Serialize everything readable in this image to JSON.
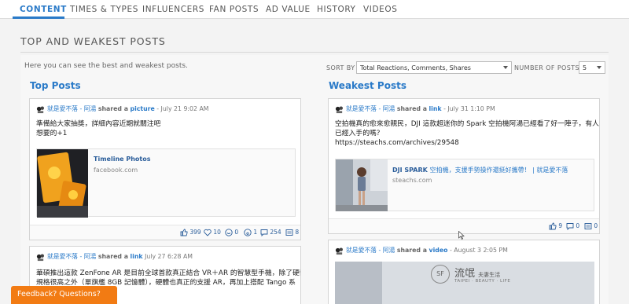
{
  "nav": {
    "tabs": [
      {
        "label": "CONTENT",
        "active": true
      },
      {
        "label": "TIMES & TYPES"
      },
      {
        "label": "INFLUENCERS"
      },
      {
        "label": "FAN POSTS"
      },
      {
        "label": "AD VALUE"
      },
      {
        "label": "HISTORY"
      },
      {
        "label": "VIDEOS"
      }
    ]
  },
  "section_title": "TOP AND WEAKEST POSTS",
  "intro": "Here you can see the best and weakest posts.",
  "controls": {
    "sort_label": "SORT BY",
    "sort_value": "Total Reactions, Comments, Shares",
    "number_label": "NUMBER OF POSTS",
    "number_value": "5"
  },
  "top": {
    "title": "Top Posts",
    "posts": [
      {
        "page": "就是愛不落 - 阿湯",
        "shared": "shared a",
        "type": "picture",
        "time": "- July 21 9:02 AM",
        "message_lines": [
          "準備給大家抽獎，詳細內容近期就關注吧",
          "想要的+1"
        ],
        "attachment": {
          "title": "Timeline Photos",
          "domain": "facebook.com"
        },
        "stats": {
          "likes": "399",
          "loves": "10",
          "haha": "0",
          "wow": "1",
          "comments": "254",
          "shares": "8"
        }
      },
      {
        "page": "就是愛不落 - 阿湯",
        "shared": "shared a",
        "type": "link",
        "time": "July 27 6:28 AM",
        "message_lines": [
          "華碩推出這款 ZenFone AR 是目前全球首款真正結合 VR＋AR 的智慧型手機，除了硬體",
          "規格很高之外（單旗艦 8GB 記憶體），硬體也真正的支援 AR，再加上搭配 Tango 系"
        ]
      }
    ]
  },
  "weak": {
    "title": "Weakest Posts",
    "posts": [
      {
        "page": "就是愛不落 - 阿湯",
        "shared": "shared a",
        "type": "link",
        "time": "- July 31 1:10 PM",
        "message_lines": [
          "空拍機真的愈來愈親民，DJI 這款超迷你的 Spark 空拍機阿湯已經看了好一陣子，有人",
          "已經入手的嗎？",
          "https://steachs.com/archives/29548"
        ],
        "attachment": {
          "title": "DJI SPARK",
          "subtitle": "空拍機，支援手勢操作還挺好攜帶！ | 就是愛不落",
          "domain": "steachs.com"
        },
        "stats": {
          "likes": "9",
          "comments": "0",
          "shares": "0"
        }
      },
      {
        "page": "就是愛不落 - 阿湯",
        "shared": "shared a",
        "type": "video",
        "time": "- August 3 2:05 PM",
        "image_text": {
          "brand": "流氓",
          "brand_sub": "夫妻生活",
          "tagline": "TAIPEI · BEAUTY · LIFE"
        }
      }
    ]
  },
  "feedback_label": "Feedback? Questions?"
}
